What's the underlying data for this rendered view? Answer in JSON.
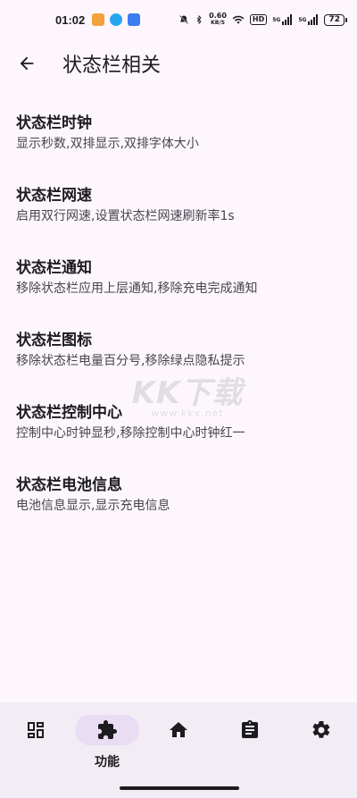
{
  "status_bar": {
    "time": "01:02",
    "net_speed_value": "0.60",
    "net_speed_unit": "KB/S",
    "hd_label": "HD",
    "signal_label_1": "5G",
    "signal_label_2": "5G",
    "battery": "72"
  },
  "header": {
    "title": "状态栏相关"
  },
  "items": [
    {
      "title": "状态栏时钟",
      "desc": "显示秒数,双排显示,双排字体大小"
    },
    {
      "title": "状态栏网速",
      "desc": "启用双行网速,设置状态栏网速刷新率1s"
    },
    {
      "title": "状态栏通知",
      "desc": "移除状态栏应用上层通知,移除充电完成通知"
    },
    {
      "title": "状态栏图标",
      "desc": "移除状态栏电量百分号,移除绿点隐私提示"
    },
    {
      "title": "状态栏控制中心",
      "desc": "控制中心时钟显秒,移除控制中心时钟红一"
    },
    {
      "title": "状态栏电池信息",
      "desc": "电池信息显示,显示充电信息"
    }
  ],
  "watermark": {
    "big": "KK下载",
    "small": "www.kkx.net"
  },
  "bottom_nav": {
    "items": [
      {
        "icon": "dashboard-icon"
      },
      {
        "icon": "puzzle-icon",
        "label": "功能",
        "active": true
      },
      {
        "icon": "home-icon"
      },
      {
        "icon": "clipboard-icon"
      },
      {
        "icon": "gear-icon"
      }
    ]
  },
  "colors": {
    "background": "#fdf7fd",
    "nav_background": "#f2ecf4",
    "active_pill": "#e8ddf4",
    "text": "#1c1b1f",
    "secondary_text": "#49454f"
  }
}
